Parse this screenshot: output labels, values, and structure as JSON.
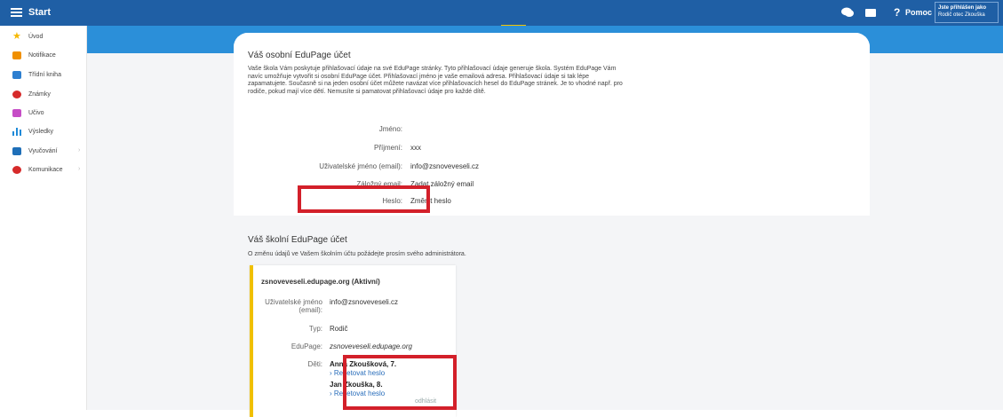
{
  "topbar": {
    "start_label": "Start",
    "help_label": "Pomoc",
    "help_icon": "?",
    "login_line1": "Jste přihlášen jako",
    "login_line2": "Rodič otec Zkouška"
  },
  "sidebar": {
    "items": [
      {
        "label": "Úvod",
        "icon": "star-icon"
      },
      {
        "label": "Notifikace",
        "icon": "notification-icon"
      },
      {
        "label": "Třídní kniha",
        "icon": "book-icon"
      },
      {
        "label": "Známky",
        "icon": "grades-icon"
      },
      {
        "label": "Učivo",
        "icon": "learning-icon"
      },
      {
        "label": "Výsledky",
        "icon": "results-icon"
      },
      {
        "label": "Vyučování",
        "icon": "teaching-icon",
        "arrow": "›"
      },
      {
        "label": "Komunikace",
        "icon": "communication-icon",
        "arrow": "›"
      }
    ]
  },
  "personal": {
    "title": "Váš osobní EduPage účet",
    "intro": "Vaše škola Vám poskytuje přihlašovací údaje na své EduPage stránky. Tyto přihlašovací údaje generuje škola. Systém EduPage Vám navíc umožňuje vytvořit si osobní EduPage účet. Přihlašovací jméno je vaše emailová adresa. Přihlašovací údaje si tak lépe zapamatujete. Současně si na jeden osobní účet můžete navázat více přihlašovacích hesel do EduPage stránek. Je to vhodné např. pro rodiče, pokud mají více dětí. Nemusíte si pamatovat přihlašovací údaje pro každé dítě.",
    "fields": {
      "first_name_label": "Jméno:",
      "first_name_value": "",
      "last_name_label": "Příjmení:",
      "last_name_value": "xxx",
      "username_label": "Uživatelské jméno (email):",
      "username_value": "info@zsnoveveseli.cz",
      "backup_email_label": "Záložný email:",
      "backup_email_link": "Zadat záložný email",
      "password_label": "Heslo:",
      "password_link": "Změnit heslo"
    }
  },
  "school": {
    "title": "Váš školní EduPage účet",
    "subtitle": "O změnu údajů ve Vašem školním účtu požádejte prosím svého administrátora.",
    "account": {
      "title": "zsnoveveseli.edupage.org (Aktivní)",
      "username_label_1": "Uživatelské jméno",
      "username_label_2": "(email):",
      "username_value": "info@zsnoveveseli.cz",
      "type_label": "Typ:",
      "type_value": "Rodič",
      "edupage_label": "EduPage:",
      "edupage_value": "zsnoveveseli.edupage.org",
      "children_label": "Děti:",
      "children": [
        {
          "name": "Anna Zkoušková, 7.",
          "reset": "Resetovat heslo"
        },
        {
          "name": "Jan Zkouška, 8.",
          "reset": "Resetovat heslo"
        }
      ],
      "logout": "odhlásit"
    }
  },
  "colors": {
    "topbar": "#1f5fa5",
    "band": "#2b8fd9",
    "highlight": "#d3202a",
    "accent": "#f0c000",
    "link": "#2a6ebb"
  }
}
